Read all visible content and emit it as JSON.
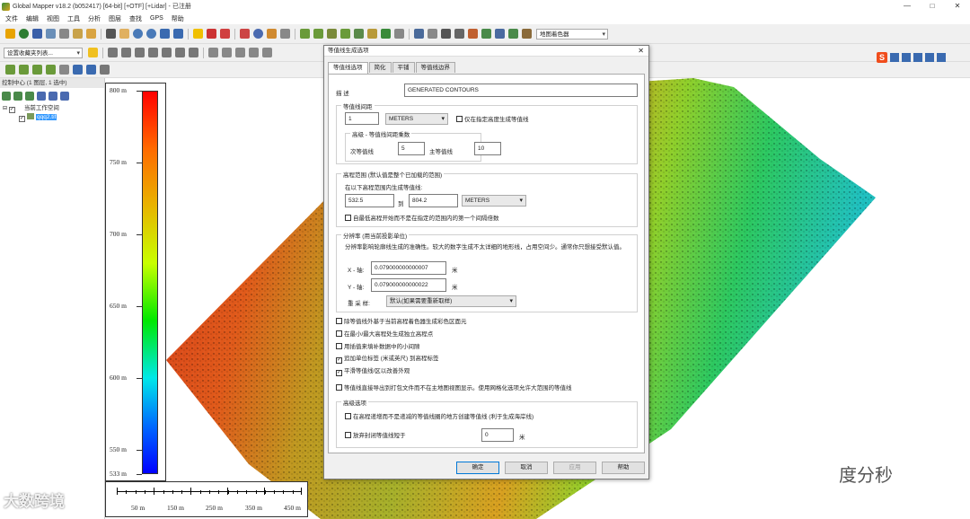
{
  "window": {
    "title": "Global Mapper v18.2 (b052417) [64-bit] [+OTF] [+Lidar] - 已注册",
    "ctrl_min": "—",
    "ctrl_max": "□",
    "ctrl_close": "✕"
  },
  "menu": [
    "文件",
    "编辑",
    "视图",
    "工具",
    "分析",
    "图层",
    "查找",
    "GPS",
    "帮助"
  ],
  "toolbar": {
    "shader_combo": "地图着色器",
    "favorites_combo": "设置收藏夹列表..."
  },
  "control_panel": {
    "header": "控制中心 (1 图层, 1 选中)",
    "workspace": "当前工作空间",
    "layer": "qqq2.tif"
  },
  "legend": {
    "ticks": [
      "800 m",
      "750 m",
      "700 m",
      "650 m",
      "600 m",
      "550 m",
      "533 m"
    ],
    "max": 800,
    "min": 533
  },
  "scalebar": {
    "labels": [
      "50 m",
      "150 m",
      "250 m",
      "350 m",
      "450 m"
    ]
  },
  "dialog": {
    "title": "等值线生成选项",
    "close": "✕",
    "tabs": [
      "等值线选项",
      "简化",
      "平铺",
      "等值线边界"
    ],
    "description_label": "描  述",
    "description_value": "GENERATED CONTOURS",
    "interval": {
      "group": "等值线间距",
      "value": "1",
      "unit": "METERS",
      "only_specified": "仅在指定高度生成等值线",
      "adv_group": "高级 - 等值线间距乘数",
      "minor_label": "次等值线",
      "minor_value": "5",
      "major_label": "主等值线",
      "major_value": "10"
    },
    "range": {
      "group": "高程范围 (默认值是整个已加载的范围)",
      "desc": "在以下高程范围内生成等值线:",
      "from": "532.5",
      "to_label": "到",
      "to": "804.2",
      "unit": "METERS",
      "start_lowest": "自最低高程开始而不是在指定的范围内的第一个间隔倍数"
    },
    "resolution": {
      "group": "分辨率 (用当前投影单位)",
      "desc": "分辨率影响轮廓线生成的准确性。较大的数字生成不太详细的地形线，占用空间少。通常你只想接受默认值。",
      "x_label": "X - 轴:",
      "x_value": "0.079000000000007",
      "x_unit": "米",
      "y_label": "Y - 轴:",
      "y_value": "0.079000000000022",
      "y_unit": "米",
      "resample_label": "重 采 样:",
      "resample_value": "默认(如果需要重新取样)"
    },
    "options": [
      {
        "label": "除等值线外基于当前高程着色器生成彩色区面元",
        "checked": false
      },
      {
        "label": "在最小/最大高程处生成独立高程点",
        "checked": false
      },
      {
        "label": "用插值来填补数据中的小间隙",
        "checked": false
      },
      {
        "label": "追加单位标签 (米或英尺) 到高程标签",
        "checked": true
      },
      {
        "label": "平滑等值线/区以改善外观",
        "checked": true
      }
    ],
    "direct_export": {
      "label": "等值线直接导出到打包文件而不在主地图视图显示。使用网格化选项允许大范围的等值线",
      "checked": false
    },
    "advanced": {
      "group": "高级选项",
      "opt1": "在高程递增而不是递减的等值线圈的地方创建等值线 (利于生成海岸线)",
      "opt2": "放弃封闭等值线短于",
      "short_value": "0",
      "short_unit": "米"
    },
    "buttons": {
      "ok": "确定",
      "cancel": "取消",
      "apply": "应用",
      "help": "帮助"
    }
  },
  "watermarks": {
    "left": "大数跨境",
    "right": "度分秒"
  },
  "colors": {
    "dialog_bg": "#f0f0f0",
    "accent": "#0078d7"
  }
}
